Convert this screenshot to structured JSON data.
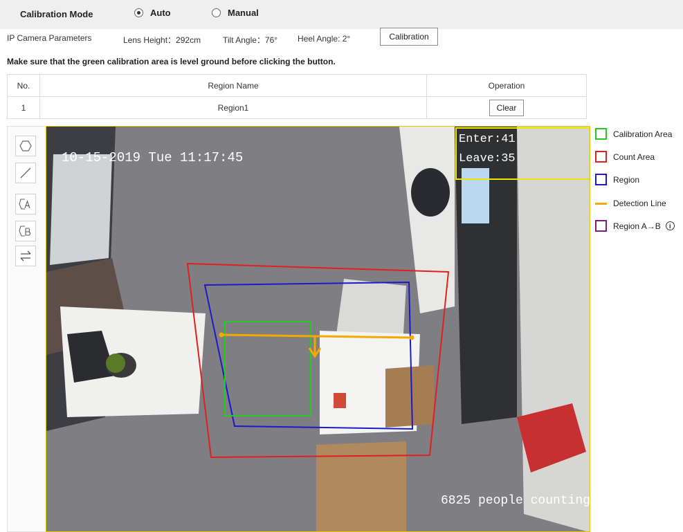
{
  "calibration_mode": {
    "title": "Calibration Mode",
    "options": [
      {
        "label": "Auto",
        "selected": true
      },
      {
        "label": "Manual",
        "selected": false
      }
    ]
  },
  "camera": {
    "label": "IP Camera Parameters",
    "lens_height": "Lens Height：292cm",
    "tilt_angle": "Tilt Angle：76°",
    "heel_angle": "Heel Angle: 2°",
    "calibration_button": "Calibration"
  },
  "hint": "Make sure that the green calibration area is level ground before clicking the button.",
  "table": {
    "headers": [
      "No.",
      "Region Name",
      "Operation"
    ],
    "rows": [
      {
        "no": "1",
        "name": "Region1",
        "operation": "Clear"
      }
    ]
  },
  "tools": [
    {
      "icon": "polygon-icon"
    },
    {
      "icon": "line-icon"
    },
    {
      "icon": "region-a-icon"
    },
    {
      "icon": "region-b-icon"
    },
    {
      "icon": "swap-direction-icon"
    }
  ],
  "video": {
    "timestamp": "10-15-2019 Tue 11:17:45",
    "enter": "Enter:41",
    "leave": "Leave:35",
    "watermark": "6825 people counting"
  },
  "legend": [
    {
      "label": "Calibration Area",
      "color": "#22cc22",
      "kind": "box"
    },
    {
      "label": "Count Area",
      "color": "#e02020",
      "kind": "box"
    },
    {
      "label": "Region",
      "color": "#1a1acc",
      "kind": "box"
    },
    {
      "label": "Detection Line",
      "color": "#f5a800",
      "kind": "line"
    },
    {
      "label": "Region A→B",
      "color": "#7a1f7a",
      "kind": "box",
      "info_icon": "info-icon"
    }
  ]
}
